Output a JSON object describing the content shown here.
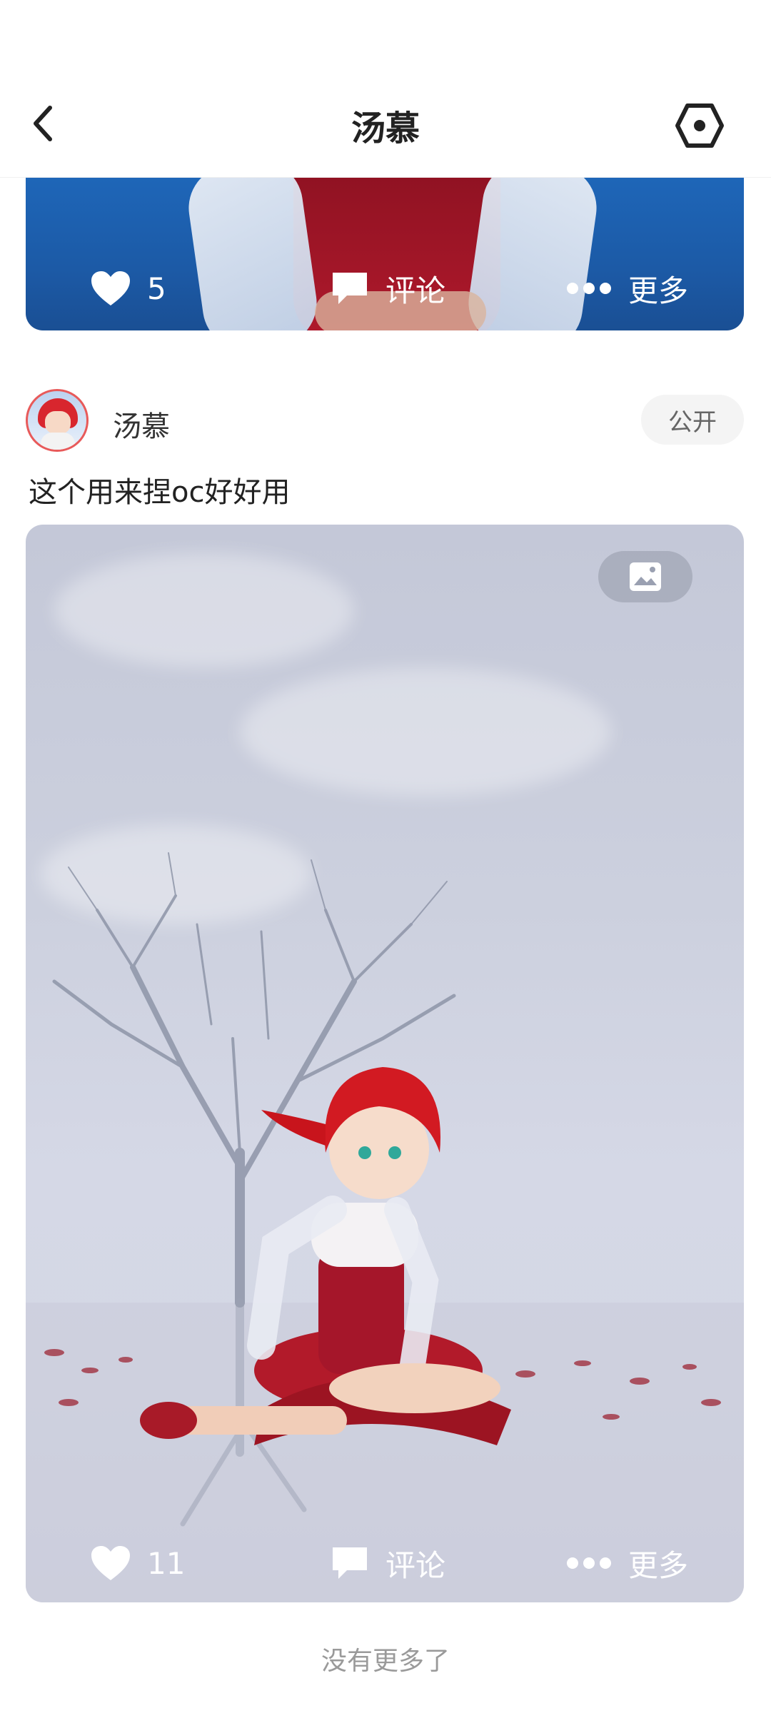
{
  "header": {
    "title": "汤慕"
  },
  "post1": {
    "likes": "5",
    "comment_label": "评论",
    "more_label": "更多"
  },
  "post2": {
    "username": "汤慕",
    "visibility": "公开",
    "text": "这个用来捏oc好好用",
    "likes": "11",
    "comment_label": "评论",
    "more_label": "更多"
  },
  "footer": {
    "end_text": "没有更多了"
  },
  "icons": {
    "back": "chevron-left-icon",
    "settings": "hexagon-settings-icon",
    "like": "heart-icon",
    "comment": "comment-bubble-icon",
    "more": "ellipsis-icon",
    "image": "image-icon"
  },
  "colors": {
    "accent_red": "#e85a5a",
    "card1_bg": "#1e66b8"
  }
}
